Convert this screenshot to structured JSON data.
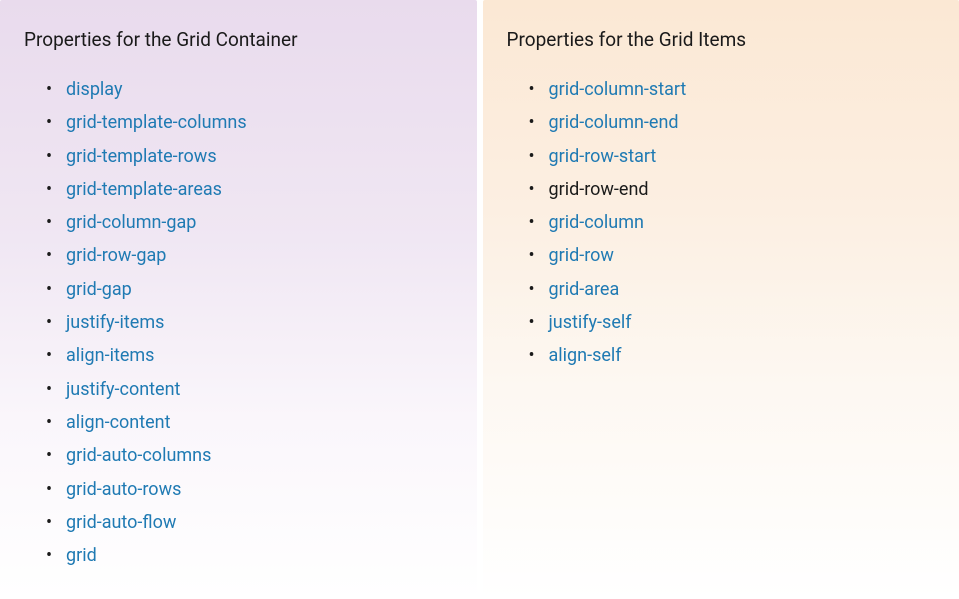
{
  "container_panel": {
    "heading": "Properties for the Grid Container",
    "properties": [
      {
        "label": "display",
        "link": true
      },
      {
        "label": "grid-template-columns",
        "link": true
      },
      {
        "label": "grid-template-rows",
        "link": true
      },
      {
        "label": "grid-template-areas",
        "link": true
      },
      {
        "label": "grid-column-gap",
        "link": true
      },
      {
        "label": "grid-row-gap",
        "link": true
      },
      {
        "label": "grid-gap",
        "link": true
      },
      {
        "label": "justify-items",
        "link": true
      },
      {
        "label": "align-items",
        "link": true
      },
      {
        "label": "justify-content",
        "link": true
      },
      {
        "label": "align-content",
        "link": true
      },
      {
        "label": "grid-auto-columns",
        "link": true
      },
      {
        "label": "grid-auto-rows",
        "link": true
      },
      {
        "label": "grid-auto-flow",
        "link": true
      },
      {
        "label": "grid",
        "link": true
      }
    ]
  },
  "items_panel": {
    "heading": "Properties for the Grid Items",
    "properties": [
      {
        "label": "grid-column-start",
        "link": true
      },
      {
        "label": "grid-column-end",
        "link": true
      },
      {
        "label": "grid-row-start",
        "link": true
      },
      {
        "label": "grid-row-end",
        "link": false
      },
      {
        "label": "grid-column",
        "link": true
      },
      {
        "label": "grid-row",
        "link": true
      },
      {
        "label": "grid-area",
        "link": true
      },
      {
        "label": "justify-self",
        "link": true
      },
      {
        "label": "align-self",
        "link": true
      }
    ]
  }
}
